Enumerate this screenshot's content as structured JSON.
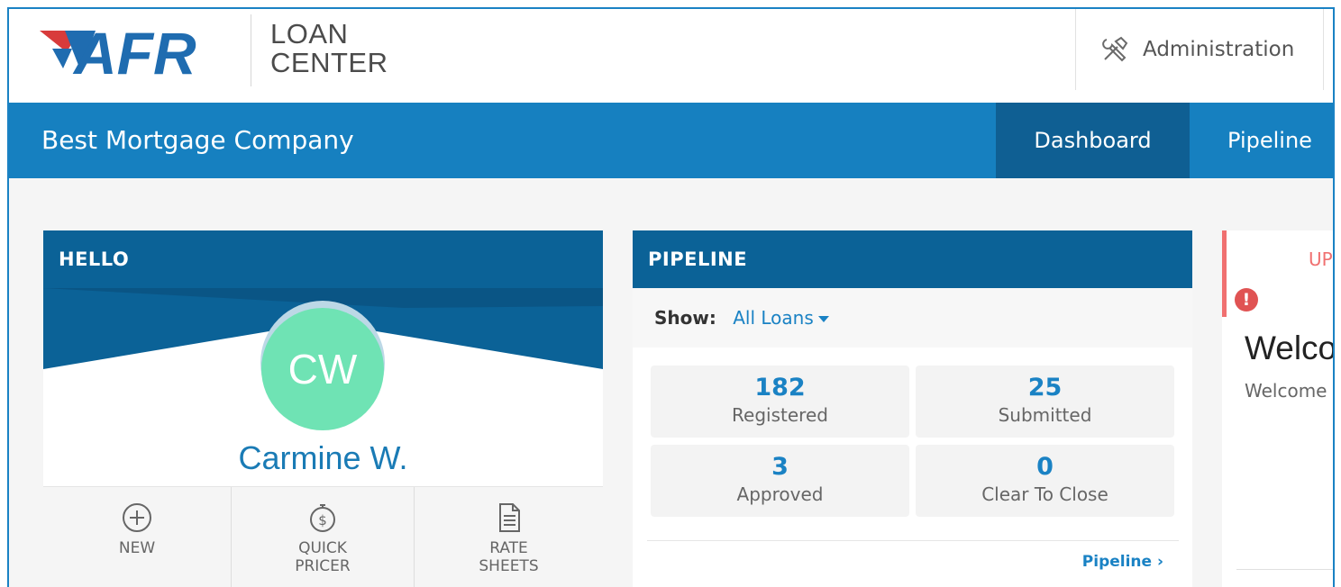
{
  "header": {
    "logo_text": "AFR",
    "logo_sub_line1": "LOAN",
    "logo_sub_line2": "CENTER",
    "admin_label": "Administration"
  },
  "navbar": {
    "company": "Best Mortgage Company",
    "tabs": [
      {
        "label": "Dashboard",
        "active": true
      },
      {
        "label": "Pipeline",
        "active": false
      }
    ]
  },
  "hello_card": {
    "title": "HELLO",
    "initials": "CW",
    "name": "Carmine W.",
    "actions": [
      {
        "icon": "plus-circle-icon",
        "line1": "NEW",
        "line2": ""
      },
      {
        "icon": "stopwatch-dollar-icon",
        "line1": "QUICK",
        "line2": "PRICER"
      },
      {
        "icon": "document-icon",
        "line1": "RATE",
        "line2": "SHEETS"
      }
    ]
  },
  "pipeline_card": {
    "title": "PIPELINE",
    "show_label": "Show:",
    "show_value": "All Loans",
    "stats": [
      {
        "value": "182",
        "label": "Registered"
      },
      {
        "value": "25",
        "label": "Submitted"
      },
      {
        "value": "3",
        "label": "Approved"
      },
      {
        "value": "0",
        "label": "Clear To Close"
      }
    ],
    "link": "Pipeline ›"
  },
  "update_card": {
    "title_fragment": "UP",
    "alert_icon": "!",
    "welcome_title": "Welco",
    "welcome_text": "Welcome"
  },
  "colors": {
    "nav_blue": "#1680c0",
    "card_header": "#0b6297",
    "active_tab": "#0f5f93",
    "avatar": "#6fe3b4",
    "link_blue": "#1a82c4",
    "alert_red": "#e05353"
  }
}
